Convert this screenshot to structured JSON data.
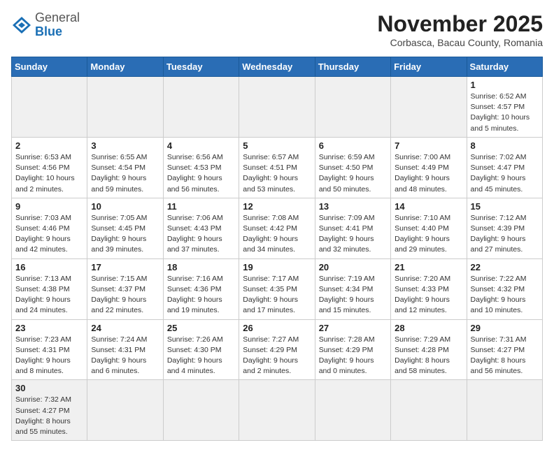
{
  "header": {
    "logo_general": "General",
    "logo_blue": "Blue",
    "month": "November 2025",
    "location": "Corbasca, Bacau County, Romania"
  },
  "days_of_week": [
    "Sunday",
    "Monday",
    "Tuesday",
    "Wednesday",
    "Thursday",
    "Friday",
    "Saturday"
  ],
  "weeks": [
    [
      {
        "day": "",
        "info": ""
      },
      {
        "day": "",
        "info": ""
      },
      {
        "day": "",
        "info": ""
      },
      {
        "day": "",
        "info": ""
      },
      {
        "day": "",
        "info": ""
      },
      {
        "day": "",
        "info": ""
      },
      {
        "day": "1",
        "info": "Sunrise: 6:52 AM\nSunset: 4:57 PM\nDaylight: 10 hours\nand 5 minutes."
      }
    ],
    [
      {
        "day": "2",
        "info": "Sunrise: 6:53 AM\nSunset: 4:56 PM\nDaylight: 10 hours\nand 2 minutes."
      },
      {
        "day": "3",
        "info": "Sunrise: 6:55 AM\nSunset: 4:54 PM\nDaylight: 9 hours\nand 59 minutes."
      },
      {
        "day": "4",
        "info": "Sunrise: 6:56 AM\nSunset: 4:53 PM\nDaylight: 9 hours\nand 56 minutes."
      },
      {
        "day": "5",
        "info": "Sunrise: 6:57 AM\nSunset: 4:51 PM\nDaylight: 9 hours\nand 53 minutes."
      },
      {
        "day": "6",
        "info": "Sunrise: 6:59 AM\nSunset: 4:50 PM\nDaylight: 9 hours\nand 50 minutes."
      },
      {
        "day": "7",
        "info": "Sunrise: 7:00 AM\nSunset: 4:49 PM\nDaylight: 9 hours\nand 48 minutes."
      },
      {
        "day": "8",
        "info": "Sunrise: 7:02 AM\nSunset: 4:47 PM\nDaylight: 9 hours\nand 45 minutes."
      }
    ],
    [
      {
        "day": "9",
        "info": "Sunrise: 7:03 AM\nSunset: 4:46 PM\nDaylight: 9 hours\nand 42 minutes."
      },
      {
        "day": "10",
        "info": "Sunrise: 7:05 AM\nSunset: 4:45 PM\nDaylight: 9 hours\nand 39 minutes."
      },
      {
        "day": "11",
        "info": "Sunrise: 7:06 AM\nSunset: 4:43 PM\nDaylight: 9 hours\nand 37 minutes."
      },
      {
        "day": "12",
        "info": "Sunrise: 7:08 AM\nSunset: 4:42 PM\nDaylight: 9 hours\nand 34 minutes."
      },
      {
        "day": "13",
        "info": "Sunrise: 7:09 AM\nSunset: 4:41 PM\nDaylight: 9 hours\nand 32 minutes."
      },
      {
        "day": "14",
        "info": "Sunrise: 7:10 AM\nSunset: 4:40 PM\nDaylight: 9 hours\nand 29 minutes."
      },
      {
        "day": "15",
        "info": "Sunrise: 7:12 AM\nSunset: 4:39 PM\nDaylight: 9 hours\nand 27 minutes."
      }
    ],
    [
      {
        "day": "16",
        "info": "Sunrise: 7:13 AM\nSunset: 4:38 PM\nDaylight: 9 hours\nand 24 minutes."
      },
      {
        "day": "17",
        "info": "Sunrise: 7:15 AM\nSunset: 4:37 PM\nDaylight: 9 hours\nand 22 minutes."
      },
      {
        "day": "18",
        "info": "Sunrise: 7:16 AM\nSunset: 4:36 PM\nDaylight: 9 hours\nand 19 minutes."
      },
      {
        "day": "19",
        "info": "Sunrise: 7:17 AM\nSunset: 4:35 PM\nDaylight: 9 hours\nand 17 minutes."
      },
      {
        "day": "20",
        "info": "Sunrise: 7:19 AM\nSunset: 4:34 PM\nDaylight: 9 hours\nand 15 minutes."
      },
      {
        "day": "21",
        "info": "Sunrise: 7:20 AM\nSunset: 4:33 PM\nDaylight: 9 hours\nand 12 minutes."
      },
      {
        "day": "22",
        "info": "Sunrise: 7:22 AM\nSunset: 4:32 PM\nDaylight: 9 hours\nand 10 minutes."
      }
    ],
    [
      {
        "day": "23",
        "info": "Sunrise: 7:23 AM\nSunset: 4:31 PM\nDaylight: 9 hours\nand 8 minutes."
      },
      {
        "day": "24",
        "info": "Sunrise: 7:24 AM\nSunset: 4:31 PM\nDaylight: 9 hours\nand 6 minutes."
      },
      {
        "day": "25",
        "info": "Sunrise: 7:26 AM\nSunset: 4:30 PM\nDaylight: 9 hours\nand 4 minutes."
      },
      {
        "day": "26",
        "info": "Sunrise: 7:27 AM\nSunset: 4:29 PM\nDaylight: 9 hours\nand 2 minutes."
      },
      {
        "day": "27",
        "info": "Sunrise: 7:28 AM\nSunset: 4:29 PM\nDaylight: 9 hours\nand 0 minutes."
      },
      {
        "day": "28",
        "info": "Sunrise: 7:29 AM\nSunset: 4:28 PM\nDaylight: 8 hours\nand 58 minutes."
      },
      {
        "day": "29",
        "info": "Sunrise: 7:31 AM\nSunset: 4:27 PM\nDaylight: 8 hours\nand 56 minutes."
      }
    ],
    [
      {
        "day": "30",
        "info": "Sunrise: 7:32 AM\nSunset: 4:27 PM\nDaylight: 8 hours\nand 55 minutes."
      },
      {
        "day": "",
        "info": ""
      },
      {
        "day": "",
        "info": ""
      },
      {
        "day": "",
        "info": ""
      },
      {
        "day": "",
        "info": ""
      },
      {
        "day": "",
        "info": ""
      },
      {
        "day": "",
        "info": ""
      }
    ]
  ]
}
